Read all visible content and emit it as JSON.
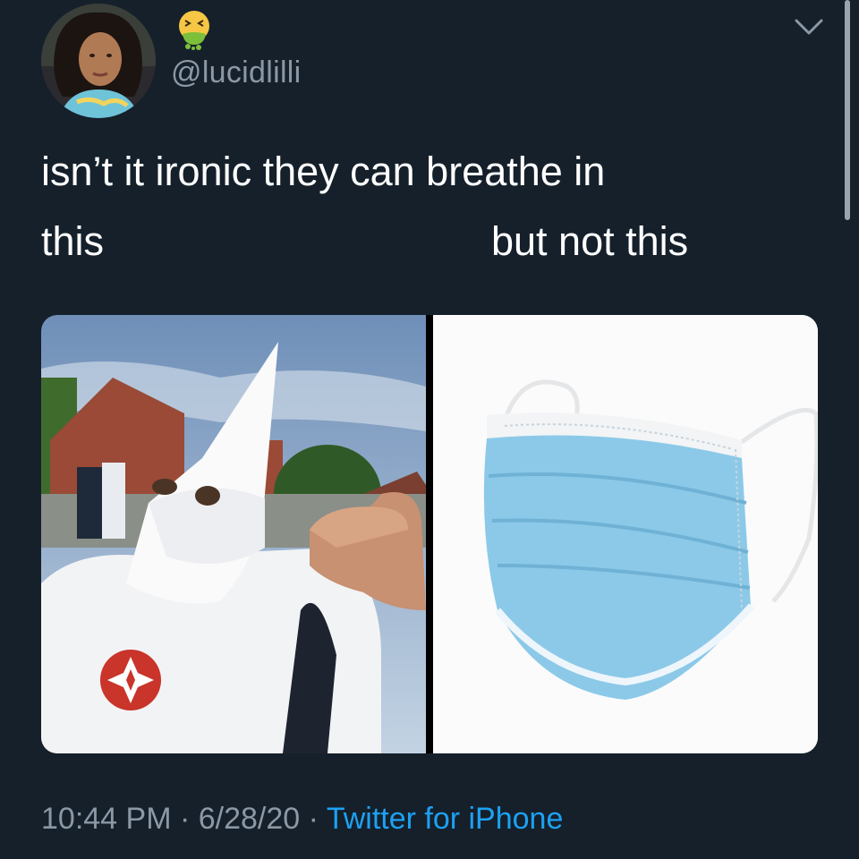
{
  "author": {
    "handle": "@lucidlilli",
    "name_emoji_icon": "nauseated-face-emoji"
  },
  "tweet": {
    "line1": "isn’t it ironic they can breathe in",
    "line2_left": "this",
    "line2_right": "but not this"
  },
  "media": {
    "left_icon": "hooded-figure-photo",
    "right_icon": "surgical-mask-photo"
  },
  "footer": {
    "time": "10:44 PM",
    "sep1": " · ",
    "date": "6/28/20",
    "sep2": " · ",
    "source": "Twitter for iPhone"
  },
  "icons": {
    "more": "chevron-down-icon"
  },
  "colors": {
    "background": "#15202b",
    "secondary_text": "#8b98a5",
    "link": "#1da1f2"
  }
}
